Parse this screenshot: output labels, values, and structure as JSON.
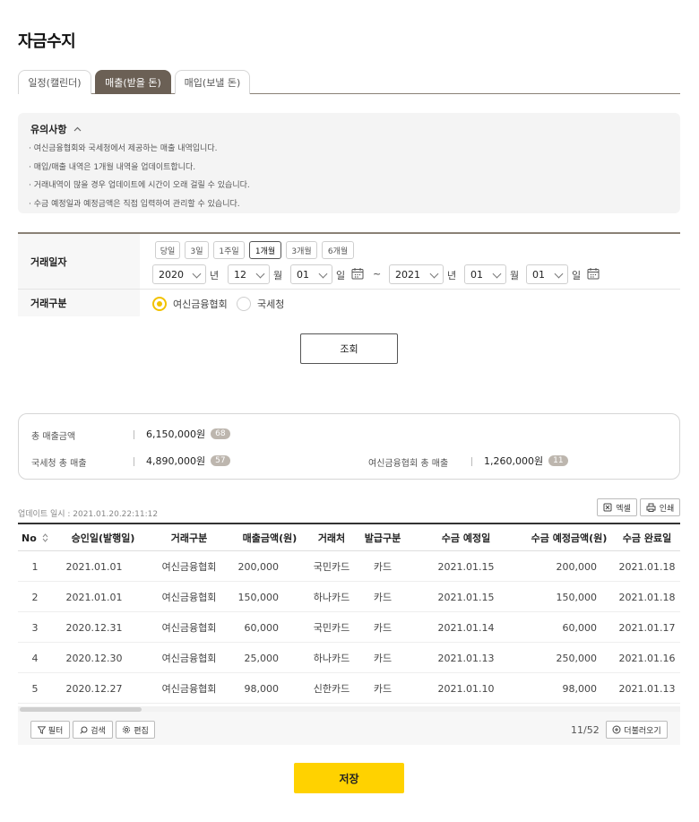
{
  "page_title": "자금수지",
  "tabs": [
    {
      "label": "일정(캘린더)"
    },
    {
      "label": "매출(받을 돈)"
    },
    {
      "label": "매입(보낼 돈)"
    }
  ],
  "active_tab": "매출(받을 돈)",
  "notice": {
    "title": "유의사항",
    "items": [
      "· 여신금융협회와 국세청에서 제공하는 매출 내역입니다.",
      "· 매입/매출 내역은 1개월 내역을 업데이트합니다.",
      "· 거래내역이 많을 경우 업데이트에 시간이 오래 걸릴 수 있습니다.",
      "· 수금 예정일과 예정금액은 직접 입력하여 관리할 수 있습니다."
    ]
  },
  "form": {
    "date_label": "거래일자",
    "type_label": "거래구분",
    "periods": [
      "당일",
      "3일",
      "1주일",
      "1개월",
      "3개월",
      "6개월"
    ],
    "active_period": "1개월",
    "from": {
      "year": "2020",
      "month": "12",
      "day": "01"
    },
    "to": {
      "year": "2021",
      "month": "01",
      "day": "01"
    },
    "units": {
      "year": "년",
      "month": "월",
      "day": "일",
      "tilde": "~"
    },
    "types": [
      "여신금융협회",
      "국세청"
    ],
    "selected_type": "여신금융협회",
    "search_label": "조회"
  },
  "summary": {
    "total_label": "총 매출금액",
    "total_value": "6,150,000원",
    "total_count": "68",
    "nts_label": "국세청 총 매출",
    "nts_value": "4,890,000원",
    "nts_count": "57",
    "card_label": "여신금융협회 총 매출",
    "card_value": "1,260,000원",
    "card_count": "11"
  },
  "update_info": "업데이트 일시 : 2021.01.20.22:11:12",
  "buttons": {
    "excel": "엑셀",
    "print": "인쇄",
    "filter": "필터",
    "search": "검색",
    "edit": "편집",
    "more": "더불러오기",
    "save": "저장"
  },
  "table": {
    "headers": [
      "No",
      "승인일(발행일)",
      "거래구분",
      "매출금액(원)",
      "거래처",
      "발급구분",
      "수금 예정일",
      "수금 예정금액(원)",
      "수금 완료일"
    ],
    "rows": [
      [
        "1",
        "2021.01.01",
        "여신금융협회",
        "200,000",
        "국민카드",
        "카드",
        "2021.01.15",
        "200,000",
        "2021.01.18"
      ],
      [
        "2",
        "2021.01.01",
        "여신금융협회",
        "150,000",
        "하나카드",
        "카드",
        "2021.01.15",
        "150,000",
        "2021.01.18"
      ],
      [
        "3",
        "2020.12.31",
        "여신금융협회",
        "60,000",
        "국민카드",
        "카드",
        "2021.01.14",
        "60,000",
        "2021.01.17"
      ],
      [
        "4",
        "2020.12.30",
        "여신금융협회",
        "25,000",
        "하나카드",
        "카드",
        "2021.01.13",
        "250,000",
        "2021.01.16"
      ],
      [
        "5",
        "2020.12.27",
        "여신금융협회",
        "98,000",
        "신한카드",
        "카드",
        "2021.01.10",
        "98,000",
        "2021.01.13"
      ]
    ],
    "page_count": "11/52"
  },
  "colors": {
    "accent": "#ffd200",
    "tab_active": "#6b6055",
    "radio": "#f2c200",
    "badge": "#bdb6ae"
  }
}
